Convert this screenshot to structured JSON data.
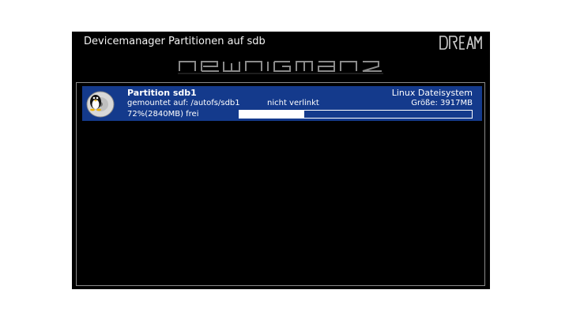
{
  "window": {
    "title": "Devicemanager Partitionen auf sdb"
  },
  "brand": {
    "logo_text": "DREAM",
    "banner_text": "newnigma2",
    "icon": "dream-logo"
  },
  "partition": {
    "name": "Partition sdb1",
    "filesystem": "Linux Dateisystem",
    "mount_info": "gemountet auf: /autofs/sdb1",
    "link_status": "nicht verlinkt",
    "size_label": "Größe: 3917MB",
    "free_label": "72%(2840MB) frei",
    "used_fraction": 0.28,
    "icon": "tux-hdd-icon"
  },
  "colors": {
    "background": "#000000",
    "row_highlight": "#143a8c",
    "text": "#ffffff"
  }
}
